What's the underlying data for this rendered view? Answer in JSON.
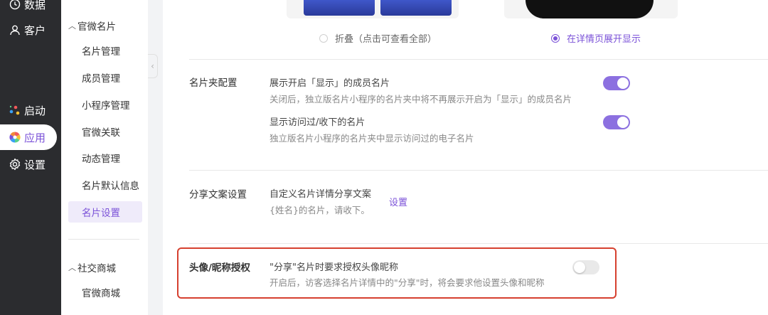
{
  "nav": {
    "items": [
      {
        "label": "数据",
        "icon": "clock-icon"
      },
      {
        "label": "客户",
        "icon": "user-icon"
      },
      {
        "label": "启动",
        "icon": "dots-icon"
      },
      {
        "label": "应用",
        "icon": "app-flower-icon"
      },
      {
        "label": "设置",
        "icon": "gear-icon"
      }
    ],
    "active": "应用"
  },
  "submenu": {
    "group1": {
      "title": "官微名片",
      "items": [
        "名片管理",
        "成员管理",
        "小程序管理",
        "官微关联",
        "动态管理",
        "名片默认信息",
        "名片设置"
      ]
    },
    "group2": {
      "title": "社交商城",
      "items": [
        "官微商城"
      ]
    },
    "active": "名片设置"
  },
  "display_mode": {
    "option_fold": "折叠（点击可查看全部）",
    "option_expand": "在详情页展开显示",
    "selected": "在详情页展开显示"
  },
  "card_folder": {
    "title": "名片夹配置",
    "opt1_title": "展示开启「显示」的成员名片",
    "opt1_desc": "关闭后，独立版名片小程序的名片夹中将不再展示开启为「显示」的成员名片",
    "opt1_on": true,
    "opt2_title": "显示访问过/收下的名片",
    "opt2_desc": "独立版名片小程序的名片夹中显示访问过的电子名片",
    "opt2_on": true
  },
  "share_copy": {
    "title": "分享文案设置",
    "label": "自定义名片详情分享文案",
    "value": "{姓名}的名片，请收下。",
    "link": "设置"
  },
  "avatar_auth": {
    "title": "头像/昵称授权",
    "opt_title": "\"分享\"名片时要求授权头像昵称",
    "opt_desc": "开启后，访客选择名片详情中的\"分享\"时，将会要求他设置头像和昵称",
    "on": false
  },
  "colors": {
    "accent": "#7b52d8",
    "toggle_on": "#8c70e0",
    "highlight": "#d6402f",
    "sidebar_dark": "#2b2c2f"
  }
}
